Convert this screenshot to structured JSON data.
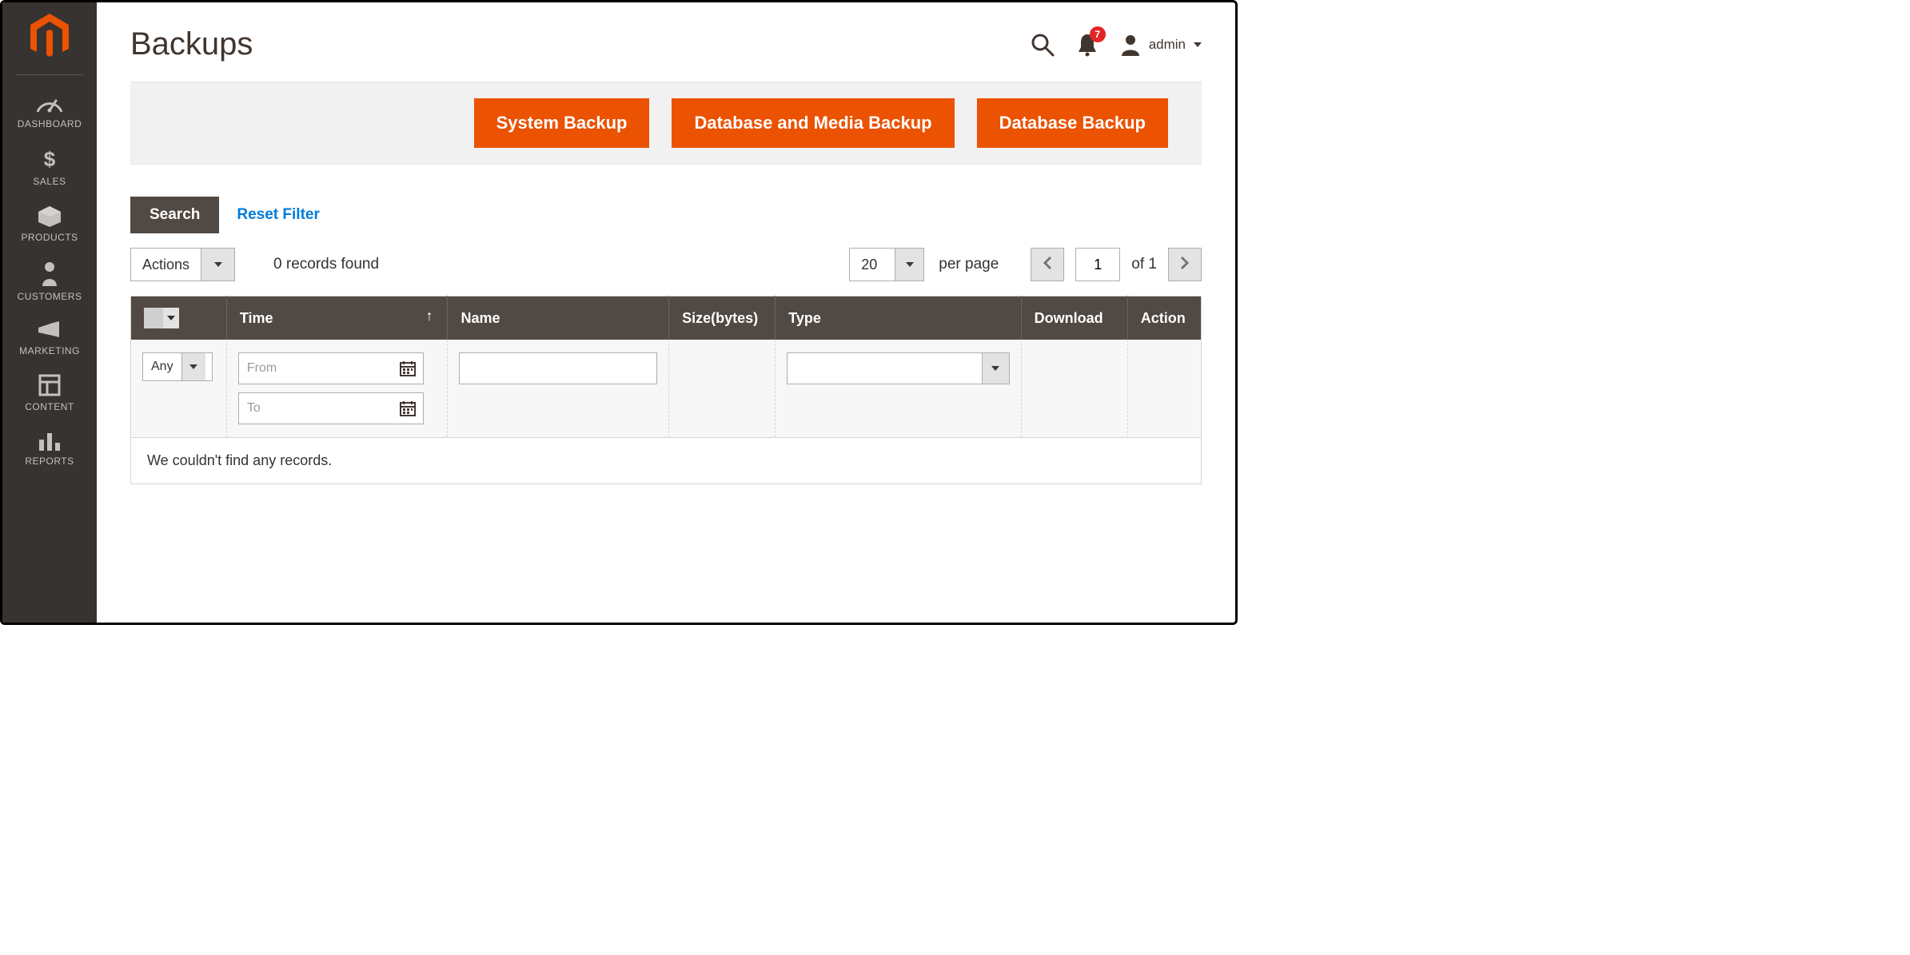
{
  "sidebar": {
    "items": [
      {
        "label": "DASHBOARD"
      },
      {
        "label": "SALES"
      },
      {
        "label": "PRODUCTS"
      },
      {
        "label": "CUSTOMERS"
      },
      {
        "label": "MARKETING"
      },
      {
        "label": "CONTENT"
      },
      {
        "label": "REPORTS"
      }
    ]
  },
  "header": {
    "title": "Backups",
    "notifications_count": "7",
    "user_name": "admin"
  },
  "action_buttons": {
    "system_backup": "System Backup",
    "db_media_backup": "Database and Media Backup",
    "db_backup": "Database Backup"
  },
  "toolbar": {
    "search_label": "Search",
    "reset_label": "Reset Filter",
    "actions_label": "Actions",
    "records_found": "0 records found",
    "per_page_value": "20",
    "per_page_label": "per page",
    "page_value": "1",
    "page_of": "of 1"
  },
  "table": {
    "headers": {
      "time": "Time",
      "name": "Name",
      "size": "Size(bytes)",
      "type": "Type",
      "download": "Download",
      "action": "Action"
    },
    "filters": {
      "any": "Any",
      "from_placeholder": "From",
      "to_placeholder": "To"
    },
    "empty_message": "We couldn't find any records."
  }
}
